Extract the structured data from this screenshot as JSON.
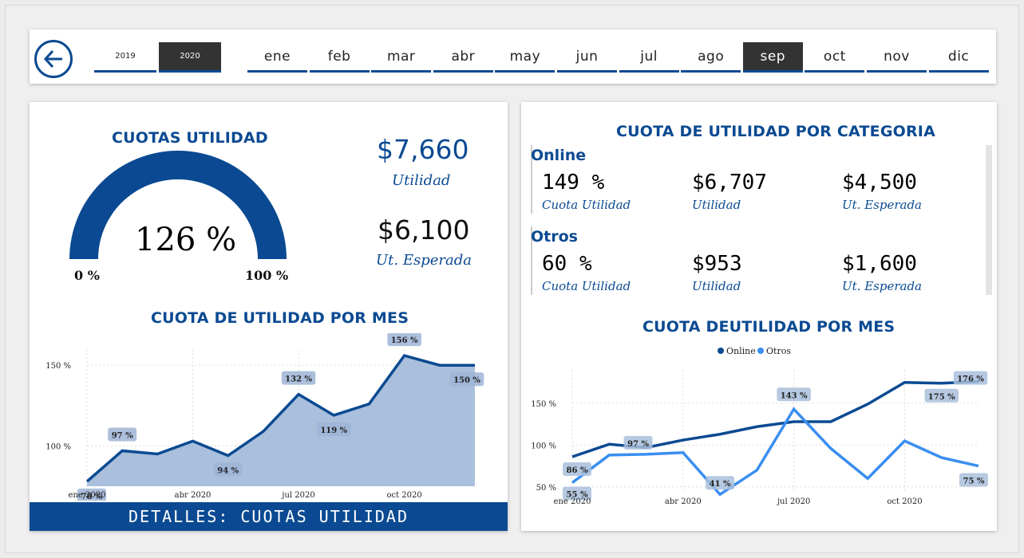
{
  "nav": {
    "years": [
      {
        "label": "2019",
        "selected": false
      },
      {
        "label": "2020",
        "selected": true
      }
    ],
    "months": [
      {
        "label": "ene",
        "selected": false
      },
      {
        "label": "feb",
        "selected": false
      },
      {
        "label": "mar",
        "selected": false
      },
      {
        "label": "abr",
        "selected": false
      },
      {
        "label": "may",
        "selected": false
      },
      {
        "label": "jun",
        "selected": false
      },
      {
        "label": "jul",
        "selected": false
      },
      {
        "label": "ago",
        "selected": false
      },
      {
        "label": "sep",
        "selected": true
      },
      {
        "label": "oct",
        "selected": false
      },
      {
        "label": "nov",
        "selected": false
      },
      {
        "label": "dic",
        "selected": false
      }
    ]
  },
  "left": {
    "gauge_title": "CUOTAS UTILIDAD",
    "gauge_value": "126 %",
    "gauge_fraction": 1.0,
    "gauge_min": "0 %",
    "gauge_max": "100 %",
    "utilidad_value": "$7,660",
    "utilidad_label": "Utilidad",
    "esperada_value": "$6,100",
    "esperada_label": "Ut. Esperada",
    "chart_title": "CUOTA DE UTILIDAD POR MES",
    "details_button": "DETALLES: CUOTAS UTILIDAD"
  },
  "right": {
    "title": "CUOTA DE UTILIDAD POR CATEGORIA",
    "categories": [
      {
        "name": "Online",
        "cuota": "149 %",
        "cuota_label": "Cuota Utilidad",
        "utilidad": "$6,707",
        "utilidad_label": "Utilidad",
        "esperada": "$4,500",
        "esperada_label": "Ut. Esperada"
      },
      {
        "name": "Otros",
        "cuota": "60 %",
        "cuota_label": "Cuota Utilidad",
        "utilidad": "$953",
        "utilidad_label": "Utilidad",
        "esperada": "$1,600",
        "esperada_label": "Ut. Esperada"
      }
    ],
    "chart_title": "CUOTA DEUTILIDAD POR MES"
  },
  "colors": {
    "accent": "#0b4a92",
    "area_fill": "#a9bfdc",
    "online": "#0b4a92",
    "otros": "#3a8ef0",
    "selected": "#333333"
  },
  "chart_data": [
    {
      "type": "area",
      "title": "CUOTA DE UTILIDAD POR MES",
      "x": [
        "ene 2020",
        "feb 2020",
        "mar 2020",
        "abr 2020",
        "may 2020",
        "jun 2020",
        "jul 2020",
        "ago 2020",
        "sep 2020",
        "oct 2020",
        "nov 2020",
        "dic 2020"
      ],
      "xticks": [
        "ene 2020",
        "abr 2020",
        "jul 2020",
        "oct 2020"
      ],
      "yticks": [
        "100 %",
        "150 %"
      ],
      "ylim": [
        75,
        160
      ],
      "series": [
        {
          "values": [
            78,
            97,
            95,
            103,
            94,
            109,
            132,
            119,
            126,
            156,
            150,
            150
          ],
          "labels": [
            {
              "i": 0,
              "text": "78 %"
            },
            {
              "i": 1,
              "text": "97 %"
            },
            {
              "i": 4,
              "text": "94 %"
            },
            {
              "i": 6,
              "text": "132 %"
            },
            {
              "i": 7,
              "text": "119 %"
            },
            {
              "i": 9,
              "text": "156 %"
            },
            {
              "i": 11,
              "text": "150 %"
            }
          ]
        }
      ],
      "grid": true
    },
    {
      "type": "line",
      "title": "CUOTA DEUTILIDAD POR MES",
      "x": [
        "ene 2020",
        "feb 2020",
        "mar 2020",
        "abr 2020",
        "may 2020",
        "jun 2020",
        "jul 2020",
        "ago 2020",
        "sep 2020",
        "oct 2020",
        "nov 2020",
        "dic 2020"
      ],
      "xticks": [
        "ene 2020",
        "abr 2020",
        "jul 2020",
        "oct 2020"
      ],
      "yticks": [
        "50 %",
        "100 %",
        "150 %"
      ],
      "ylim": [
        45,
        190
      ],
      "legend": "top-center",
      "series": [
        {
          "name": "Online",
          "color": "#0b4a92",
          "values": [
            86,
            101,
            97,
            106,
            113,
            122,
            128,
            128,
            149,
            175,
            174,
            176
          ],
          "labels": [
            {
              "i": 0,
              "text": "86 %"
            },
            {
              "i": 10,
              "text": "175 %"
            },
            {
              "i": 11,
              "text": "176 %"
            }
          ]
        },
        {
          "name": "Otros",
          "color": "#3a8ef0",
          "values": [
            55,
            88,
            89,
            91,
            41,
            70,
            143,
            96,
            60,
            105,
            85,
            75
          ],
          "labels": [
            {
              "i": 0,
              "text": "55 %"
            },
            {
              "i": 2,
              "text": "97 %"
            },
            {
              "i": 4,
              "text": "41 %"
            },
            {
              "i": 6,
              "text": "143 %"
            },
            {
              "i": 11,
              "text": "75 %"
            }
          ]
        }
      ],
      "grid": true
    }
  ]
}
